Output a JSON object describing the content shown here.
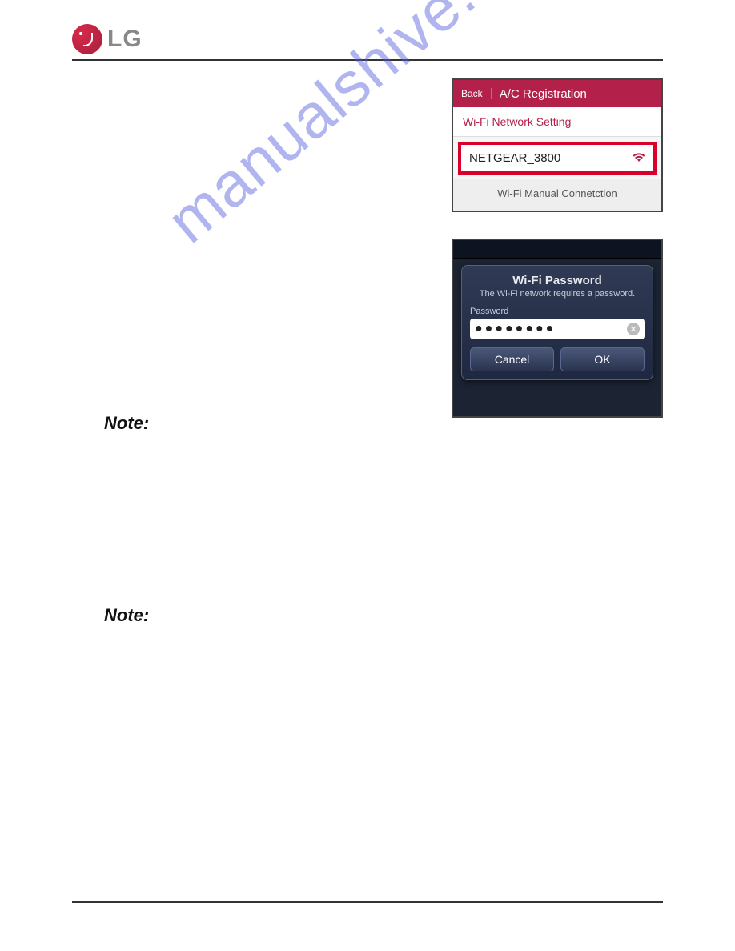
{
  "header": {
    "brand": "LG"
  },
  "shot1": {
    "back": "Back",
    "title": "A/C Registration",
    "wifi_setting": "Wi-Fi Network Setting",
    "network_name": "NETGEAR_3800",
    "manual": "Wi-Fi Manual Connetction"
  },
  "shot2": {
    "title": "Wi-Fi Password",
    "subtitle": "The Wi-Fi network requires a password.",
    "password_label": "Password",
    "password_mask": "●●●●●●●●",
    "cancel": "Cancel",
    "ok": "OK"
  },
  "notes": {
    "note1": "Note:",
    "note2": "Note:"
  },
  "watermark": "manualshive.com"
}
